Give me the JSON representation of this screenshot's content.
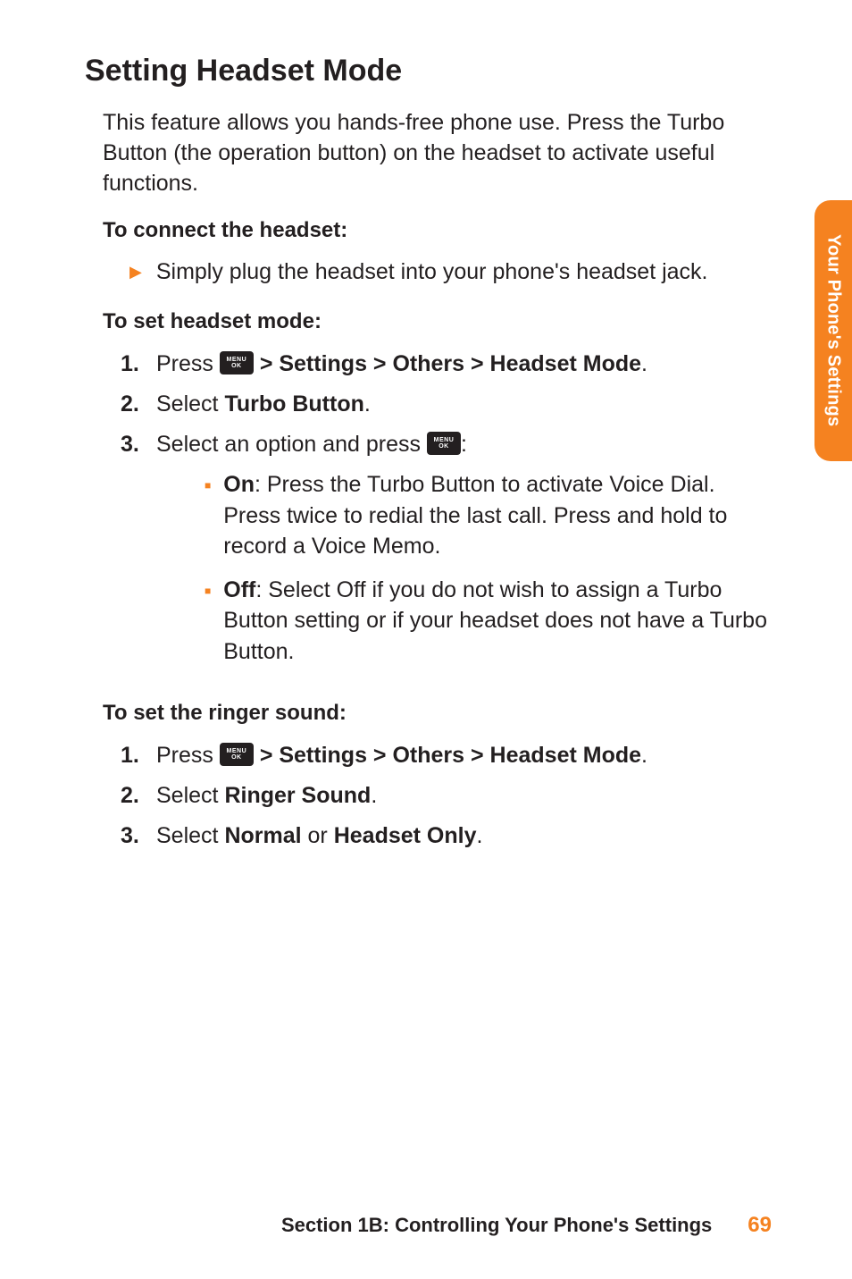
{
  "sideTab": "Your Phone's Settings",
  "h1": "Setting Headset Mode",
  "intro": "This feature allows you hands-free phone use. Press the Turbo Button (the operation button) on the headset to activate useful functions.",
  "sub_connect": "To connect the headset:",
  "connect_item": "Simply plug the headset into your phone's headset jack.",
  "sub_setmode": "To set headset mode:",
  "setmode": {
    "n1": "1.",
    "n1_press": "Press ",
    "n1_path": " > Settings > Others > Headset Mode",
    "n1_dot": ".",
    "n2": "2.",
    "n2_select": "Select ",
    "n2_bold": "Turbo Button",
    "n2_dot": ".",
    "n3": "3.",
    "n3_text_a": "Select an option and press ",
    "n3_text_b": ":",
    "b_on_label": "On",
    "b_on_text": ": Press the Turbo Button to activate Voice Dial. Press twice to redial the last call. Press and hold to record a Voice Memo.",
    "b_off_label": "Off",
    "b_off_text": ": Select Off if you do not wish to assign a Turbo Button setting or if your headset does not have a Turbo Button."
  },
  "sub_ringer": "To set the ringer sound:",
  "ringer": {
    "n1": "1.",
    "n1_press": "Press ",
    "n1_path": " > Settings > Others > Headset Mode",
    "n1_dot": ".",
    "n2": "2.",
    "n2_select": "Select ",
    "n2_bold": "Ringer Sound",
    "n2_dot": ".",
    "n3": "3.",
    "n3_select": "Select ",
    "n3_bold_a": "Normal",
    "n3_or": " or ",
    "n3_bold_b": "Headset Only",
    "n3_dot": "."
  },
  "menuIcon": {
    "top": "MENU",
    "bottom": "OK"
  },
  "footer": {
    "title": "Section 1B: Controlling Your Phone's Settings",
    "page": "69"
  }
}
